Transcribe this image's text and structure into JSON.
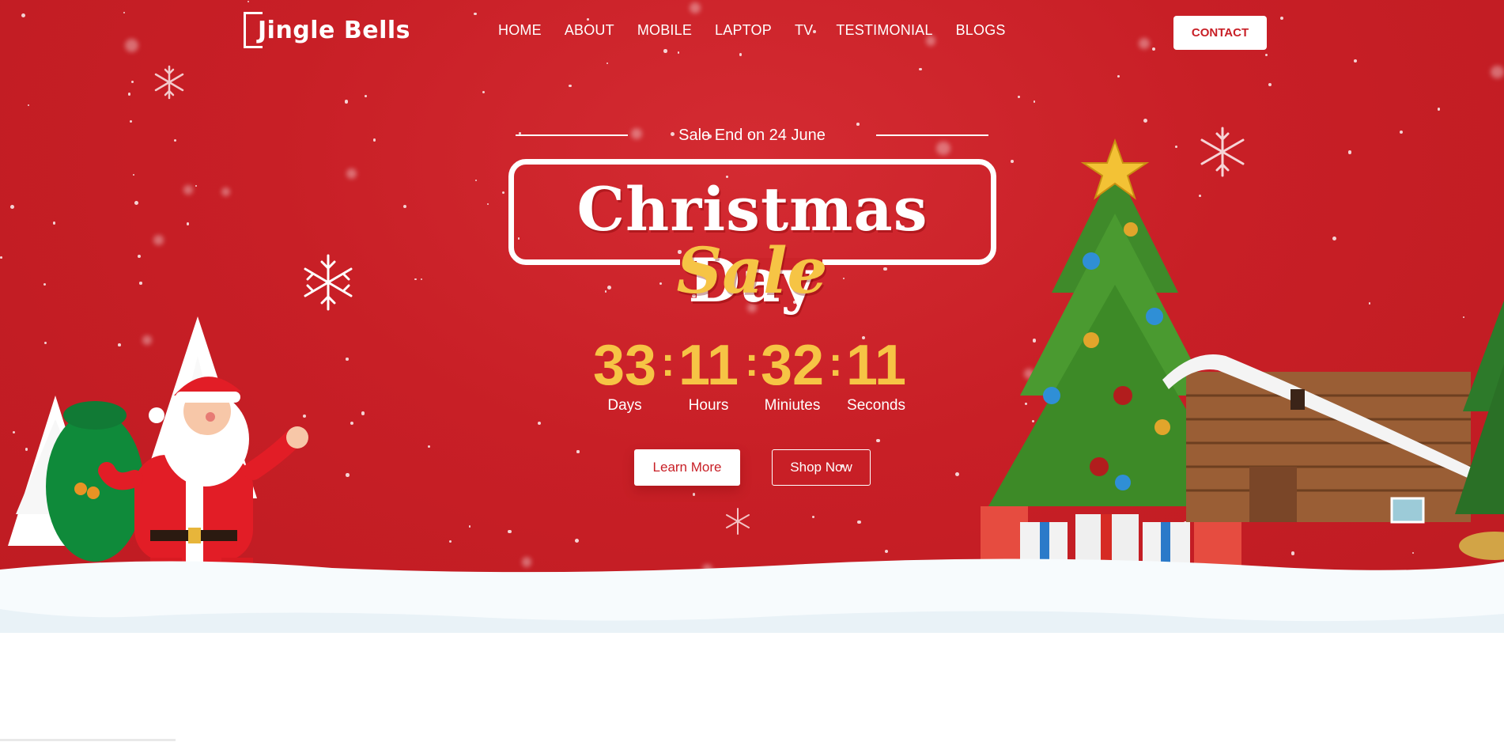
{
  "brand": {
    "logo_text": "Jingle Bells",
    "red": "#c81f26",
    "gold": "#f6c445"
  },
  "nav": {
    "items": [
      "HOME",
      "ABOUT",
      "MOBILE",
      "LAPTOP",
      "TV",
      "TESTIMONIAL",
      "BLOGS"
    ],
    "contact_label": "CONTACT"
  },
  "hero": {
    "sale_end": "Sale End on 24 June",
    "title": "Christmas Day",
    "title_highlight": "Sale",
    "countdown": {
      "days": "33",
      "hours": "11",
      "minutes": "32",
      "seconds": "11",
      "days_label": "Days",
      "hours_label": "Hours",
      "minutes_label": "Miniutes",
      "seconds_label": "Seconds",
      "separator": ":"
    },
    "learn_more_label": "Learn More",
    "shop_now_label": "Shop Now"
  },
  "icons": {
    "logo": "bracket-j-logo-icon",
    "santa": "santa-illustration",
    "tree": "christmas-tree-illustration",
    "cabin": "log-cabin-illustration",
    "snowflake": "snowflake-icon",
    "gifts": "gift-boxes-illustration"
  }
}
